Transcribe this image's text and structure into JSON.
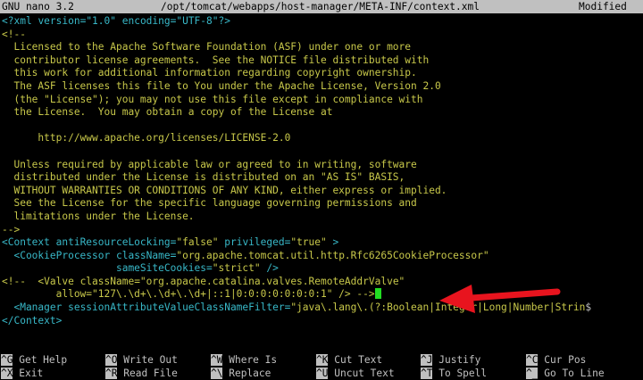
{
  "titlebar": {
    "app": "GNU nano 3.2",
    "path": "/opt/tomcat/webapps/host-manager/META-INF/context.xml",
    "status": "Modified"
  },
  "editor": {
    "xml_decl": {
      "open": "<?xml",
      "attrs": "version=\"1.0\" encoding=\"UTF-8\"?>"
    },
    "comment_open": "<!--",
    "license_lines": [
      "  Licensed to the Apache Software Foundation (ASF) under one or more",
      "  contributor license agreements.  See the NOTICE file distributed with",
      "  this work for additional information regarding copyright ownership.",
      "  The ASF licenses this file to You under the Apache License, Version 2.0",
      "  (the \"License\"); you may not use this file except in compliance with",
      "  the License.  You may obtain a copy of the License at",
      "",
      "      http://www.apache.org/licenses/LICENSE-2.0",
      "",
      "  Unless required by applicable law or agreed to in writing, software",
      "  distributed under the License is distributed on an \"AS IS\" BASIS,",
      "  WITHOUT WARRANTIES OR CONDITIONS OF ANY KIND, either express or implied.",
      "  See the License for the specific language governing permissions and",
      "  limitations under the License."
    ],
    "comment_close": "-->",
    "context_line": {
      "tag": "<Context",
      "attr1": " antiResourceLocking=",
      "val1": "\"false\"",
      "attr2": " privileged=",
      "val2": "\"true\"",
      "end": " >"
    },
    "cookie_line1": {
      "tag": "  <CookieProcessor",
      "attr": " className=",
      "val": "\"org.apache.tomcat.util.http.Rfc6265CookieProcessor\""
    },
    "cookie_line2": {
      "attr": "                   sameSiteCookies=",
      "val": "\"strict\"",
      "end": " />"
    },
    "valve_line1": {
      "comment": "<!--",
      "text": "  <Valve className=\"org.apache.catalina.valves.RemoteAddrValve\""
    },
    "valve_line2": {
      "text": "         allow=\"127\\.\\d+\\.\\d+\\.\\d+|::1|0:0:0:0:0:0:0:1\" /> -->"
    },
    "manager_line": {
      "tag": "  <Manager",
      "attr": " sessionAttributeValueClassNameFilter=",
      "val": "\"java\\.lang\\.(?:Boolean|Integer|Long|Number|Strin",
      "overflow": "$"
    },
    "context_close": "</Context>",
    "colors": {
      "cyan": "#38b8c8",
      "yellow": "#c8c84a",
      "cursor": "#22dd22",
      "arrow": "#e8141e"
    }
  },
  "shortcuts": {
    "row1": [
      {
        "key": "^G",
        "label": "Get Help"
      },
      {
        "key": "^O",
        "label": "Write Out"
      },
      {
        "key": "^W",
        "label": "Where Is"
      },
      {
        "key": "^K",
        "label": "Cut Text"
      },
      {
        "key": "^J",
        "label": "Justify"
      },
      {
        "key": "^C",
        "label": "Cur Pos"
      }
    ],
    "row2": [
      {
        "key": "^X",
        "label": "Exit"
      },
      {
        "key": "^R",
        "label": "Read File"
      },
      {
        "key": "^\\",
        "label": "Replace"
      },
      {
        "key": "^U",
        "label": "Uncut Text"
      },
      {
        "key": "^T",
        "label": "To Spell"
      },
      {
        "key": "^_",
        "label": "Go To Line"
      }
    ]
  }
}
